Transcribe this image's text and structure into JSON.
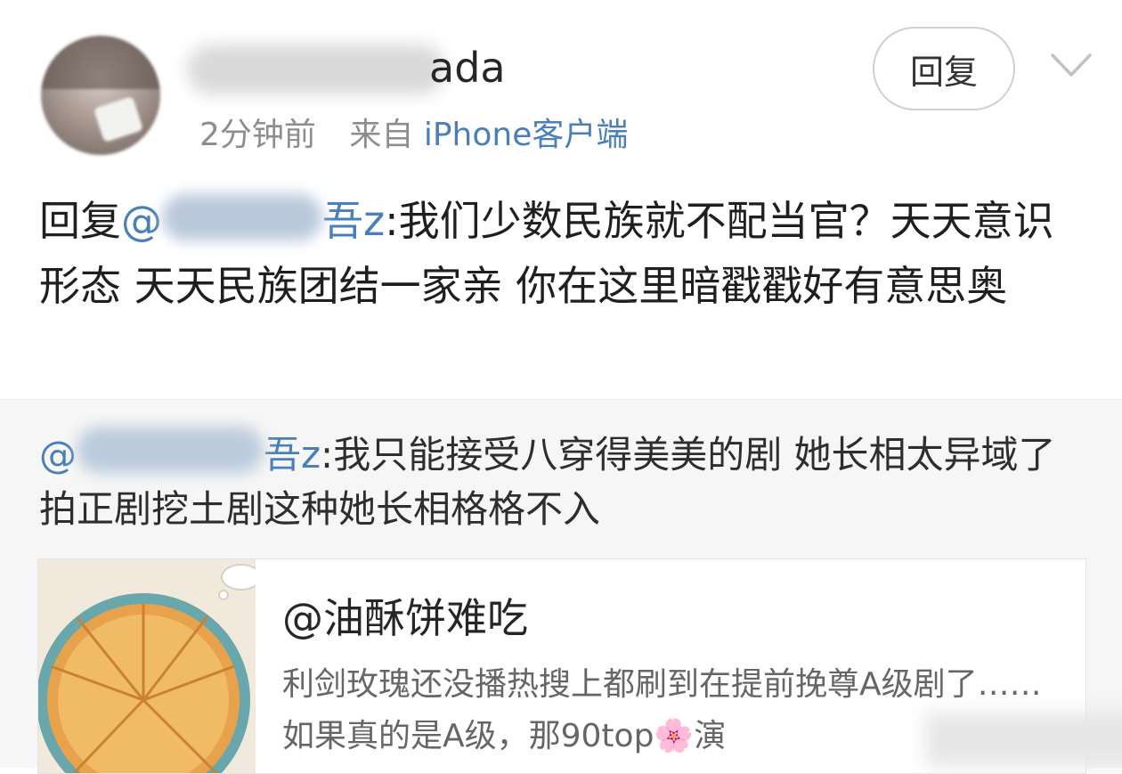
{
  "post": {
    "username_visible_part": "ada",
    "timestamp": "2分钟前",
    "source_label": "来自",
    "source_client": "iPhone客户端",
    "reply_button": "回复",
    "reply_prefix": "回复",
    "reply_mention_prefix": "@",
    "reply_mention_suffix": "吾z",
    "body_text": ":我们少数民族就不配当官？天天意识形态 天天民族团结一家亲 你在这里暗戳戳好有意思奥"
  },
  "quoted": {
    "mention_prefix": "@",
    "mention_suffix": "吾z",
    "text": ":我只能接受八穿得美美的剧 她长相太异域了 拍正剧挖土剧这种她长相格格不入"
  },
  "card": {
    "title": "@油酥饼难吃",
    "description": "利剑玫瑰还没播热搜上都刷到在提前挽尊A级剧了……如果真的是A级，那90top🌸演"
  },
  "icons": {
    "chevron": "chevron-down-icon",
    "avatar": "avatar",
    "thumbnail": "pie-thumbnail"
  },
  "colors": {
    "link": "#4a7fb8",
    "muted": "#8d8d8d"
  }
}
